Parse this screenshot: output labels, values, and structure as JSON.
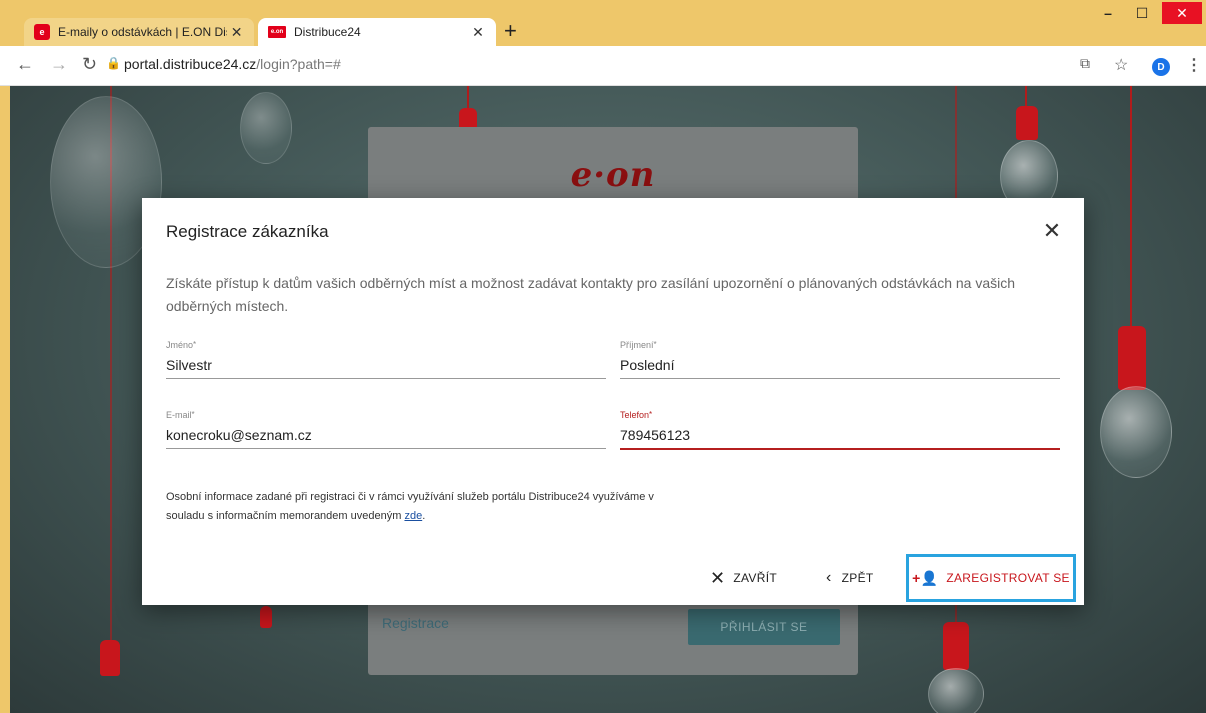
{
  "browser": {
    "tabs": [
      {
        "title": "E-maily o odstávkách | E.ON Disti",
        "favicon": "eon-favicon",
        "active": false
      },
      {
        "title": "Distribuce24",
        "favicon": "eon-favicon",
        "active": true
      }
    ],
    "url_host": "portal.distribuce24.cz",
    "url_path": "/login?path=#",
    "profile_initial": "D"
  },
  "background_card": {
    "logo": "e·on",
    "register_link": "Registrace",
    "login_button": "PŘIHLÁSIT SE"
  },
  "modal": {
    "title": "Registrace zákazníka",
    "description": "Získáte přístup k datům vašich odběrných míst a možnost zadávat kontakty pro zasílání upozornění o plánovaných odstávkách na vašich odběrných místech.",
    "fields": {
      "jmeno": {
        "label": "Jméno",
        "value": "Silvestr"
      },
      "prijmeni": {
        "label": "Příjmení",
        "value": "Poslední"
      },
      "email": {
        "label": "E-mail",
        "value": "konecroku@seznam.cz"
      },
      "telefon": {
        "label": "Telefon",
        "value": "789456123"
      }
    },
    "required_mark": "*",
    "privacy_text_1": "Osobní informace zadané při registraci či v rámci využívání služeb portálu Distribuce24 využíváme v",
    "privacy_text_2": "souladu s informačním memorandem uvedeným ",
    "privacy_link": "zde",
    "privacy_end": ".",
    "actions": {
      "close": "ZAVŘÍT",
      "back": "ZPĚT",
      "register": "ZAREGISTROVAT SE"
    }
  },
  "colors": {
    "accent_red": "#c8161c",
    "highlight_blue": "#29a3df",
    "browser_frame": "#eec76a"
  }
}
